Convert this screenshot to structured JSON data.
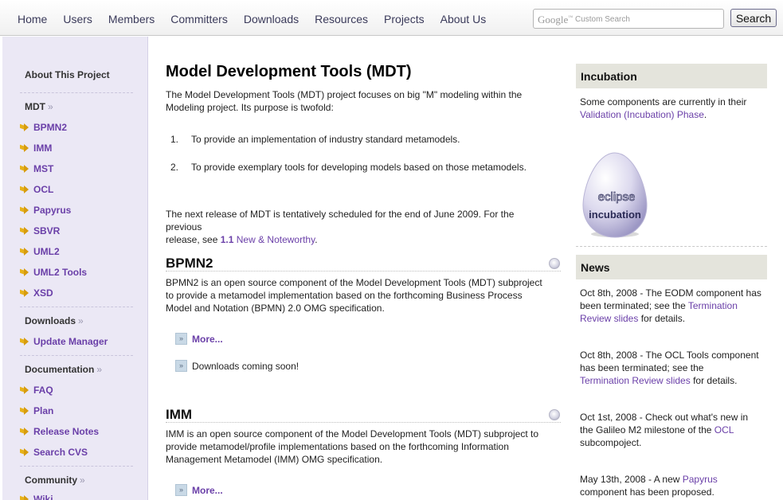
{
  "topnav": {
    "items": [
      "Home",
      "Users",
      "Members",
      "Committers",
      "Downloads",
      "Resources",
      "Projects",
      "About Us"
    ]
  },
  "search": {
    "google_word": "Google",
    "placeholder": "Custom Search",
    "button_label": "Search"
  },
  "sidebar": {
    "about": "About This Project",
    "mdt_header": "MDT",
    "mdt_items": [
      "BPMN2",
      "IMM",
      "MST",
      "OCL",
      "Papyrus",
      "SBVR",
      "UML2",
      "UML2 Tools",
      "XSD"
    ],
    "downloads_header": "Downloads",
    "downloads_items": [
      "Update Manager"
    ],
    "documentation_header": "Documentation",
    "documentation_items": [
      "FAQ",
      "Plan",
      "Release Notes",
      "Search CVS"
    ],
    "community_header": "Community",
    "community_items": [
      "Wiki"
    ],
    "chevron": "»"
  },
  "main": {
    "title": "Model Development Tools (MDT)",
    "intro_line1": "The Model Development Tools (MDT) project focuses on big \"M\" modeling within the",
    "intro_line2": "Modeling project. Its purpose is twofold:",
    "list": [
      {
        "num": "1.",
        "text": "To provide an implementation of industry standard metamodels."
      },
      {
        "num": "2.",
        "text": "To provide exemplary tools for developing models based on those metamodels."
      }
    ],
    "release_line1": "The next release of MDT is tentatively scheduled for the end of June 2009. For the previous",
    "release_pre": "release, see ",
    "release_link_bold": "1.1",
    "release_link": " New & Noteworthy",
    "release_post": ".",
    "sections": [
      {
        "title": "BPMN2",
        "lines": [
          "BPMN2 is an open source component of the Model Development Tools (MDT) subproject",
          "to provide a metamodel implementation based on the forthcoming Business Process",
          "Model and Notation (BPMN) 2.0 OMG specification."
        ],
        "more": "More...",
        "downloads": "Downloads coming soon!"
      },
      {
        "title": "IMM",
        "lines": [
          "IMM is an open source component of the Model Development Tools (MDT) subproject to",
          "provide metamodel/profile implementations based on the forthcoming Information",
          "Management Metamodel (IMM) OMG specification."
        ],
        "more": "More..."
      }
    ]
  },
  "right": {
    "incubation_title": "Incubation",
    "incubation_line1": "Some components are currently in their",
    "incubation_link": "Validation (Incubation) Phase",
    "incubation_post": ".",
    "egg_top": "eclipse",
    "egg_bottom": "incubation",
    "news_title": "News",
    "news": [
      {
        "l1": "Oct 8th, 2008 - The EODM component has",
        "l2a": "been terminated; see the ",
        "l2link": "Termination",
        "l3link": "Review slides",
        "l3post": " for details."
      },
      {
        "l1": "Oct 8th, 2008 - The OCL Tools component",
        "l2a": "has been terminated; see the",
        "l3link": "Termination Review slides",
        "l3post": " for details."
      },
      {
        "l1": "Oct 1st, 2008 - Check out what's new in",
        "l2a": "the Galileo M2 milestone of the ",
        "l2link": "OCL",
        "l3post": "subcompoject."
      },
      {
        "l1a": "May 13th, 2008 - A new ",
        "l1link": "Papyrus",
        "l2a": "component has been proposed."
      }
    ]
  }
}
